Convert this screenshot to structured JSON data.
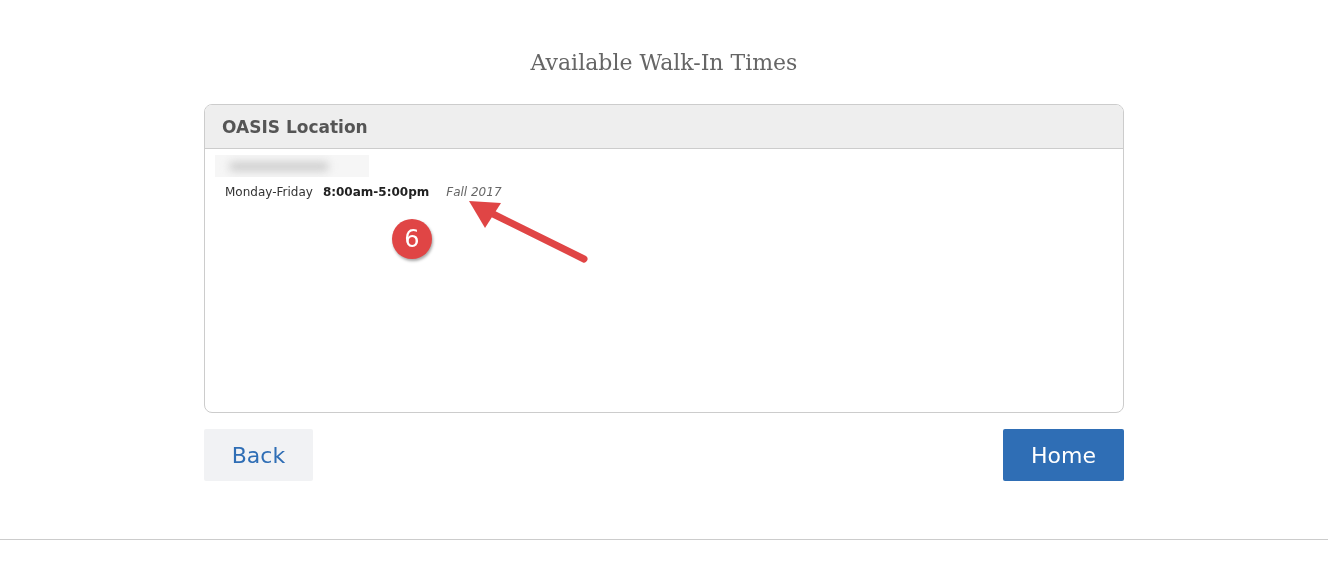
{
  "page_title": "Available Walk-In Times",
  "location_card": {
    "header": "OASIS Location",
    "schedule": [
      {
        "days": "Monday-Friday",
        "hours": "8:00am-5:00pm",
        "term": "Fall 2017"
      }
    ]
  },
  "callout": {
    "label": "6"
  },
  "buttons": {
    "back": "Back",
    "home": "Home"
  }
}
